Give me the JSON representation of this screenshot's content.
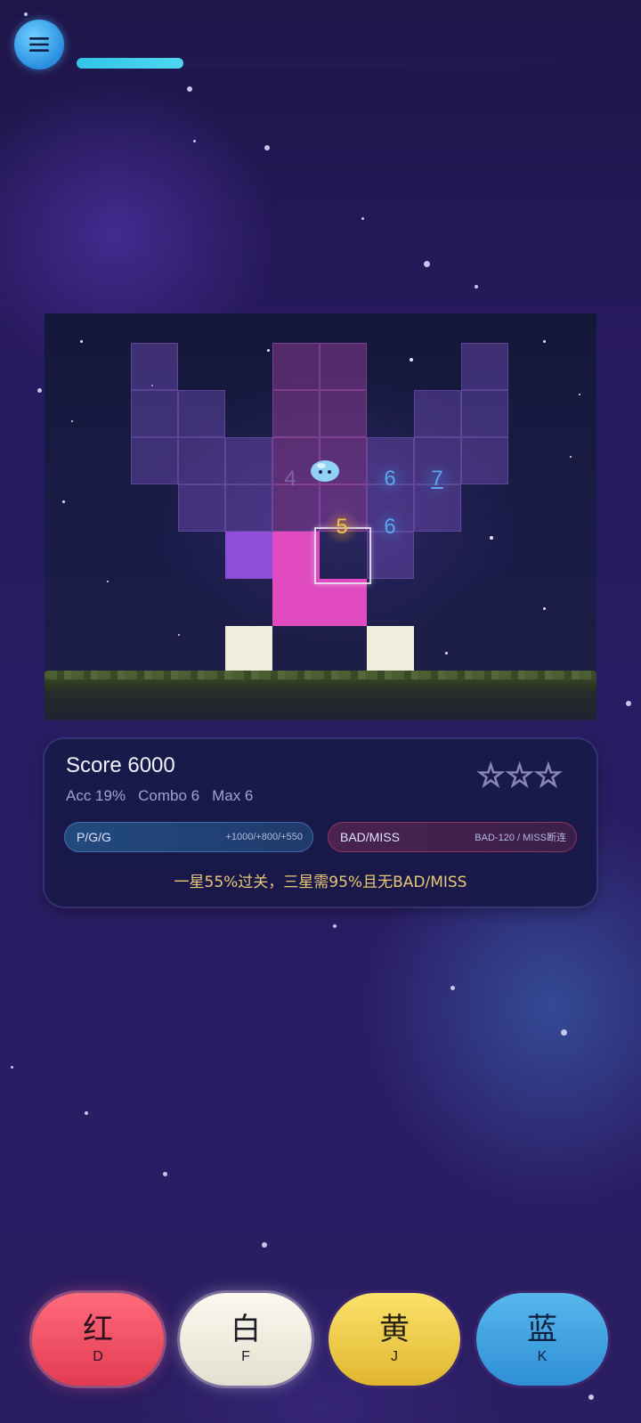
{
  "progress": {
    "value": 0.2
  },
  "score": {
    "label": "Score 6000"
  },
  "stats": {
    "acc": "Acc 19%",
    "combo": "Combo 6",
    "max": "Max 6"
  },
  "star_rating": {
    "earned": 0,
    "total": 3,
    "glyph": "☆"
  },
  "judgements": {
    "good_label": "P/G/G",
    "good_points": "+1000/+800/+550",
    "bad_label": "BAD/MISS",
    "bad_points": "BAD-120 / MISS断连"
  },
  "hint": "一星55%过关，三星需95%且无BAD/MISS",
  "board_numbers": {
    "n4": "4",
    "n6a": "6",
    "n7": "7",
    "n5": "5",
    "n6b": "6"
  },
  "keys": [
    {
      "label": "红",
      "shortcut": "D",
      "color": "#e8475e"
    },
    {
      "label": "白",
      "shortcut": "F",
      "color": "#f1eddc"
    },
    {
      "label": "黄",
      "shortcut": "J",
      "color": "#f0ca40"
    },
    {
      "label": "蓝",
      "shortcut": "K",
      "color": "#3fa3e2"
    }
  ],
  "colors": {
    "accent": "#32c4e8",
    "pink": "#e04bc0",
    "purple": "#8e4fd8"
  }
}
